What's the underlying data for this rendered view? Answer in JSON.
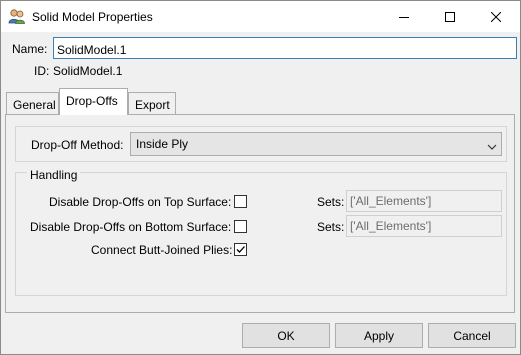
{
  "window": {
    "title": "Solid Model Properties",
    "minimize_icon": "minimize-icon",
    "maximize_icon": "maximize-icon",
    "close_icon": "close-icon",
    "app_icon": "users-icon"
  },
  "form": {
    "name_label": "Name:",
    "name_value": "SolidModel.1",
    "id_label": "ID:",
    "id_value": "SolidModel.1"
  },
  "tabs": [
    {
      "label": "General",
      "active": false
    },
    {
      "label": "Drop-Offs",
      "active": true
    },
    {
      "label": "Export",
      "active": false
    }
  ],
  "dropoffs": {
    "method_label": "Drop-Off Method:",
    "method_value": "Inside Ply",
    "handling_title": "Handling",
    "top_label": "Disable Drop-Offs on Top Surface:",
    "top_checked": false,
    "top_sets_label": "Sets:",
    "top_sets_value": "['All_Elements']",
    "bottom_label": "Disable Drop-Offs on Bottom Surface:",
    "bottom_checked": false,
    "bottom_sets_label": "Sets:",
    "bottom_sets_value": "['All_Elements']",
    "butt_label": "Connect Butt-Joined Plies:",
    "butt_checked": true
  },
  "buttons": {
    "ok": "OK",
    "apply": "Apply",
    "cancel": "Cancel"
  }
}
